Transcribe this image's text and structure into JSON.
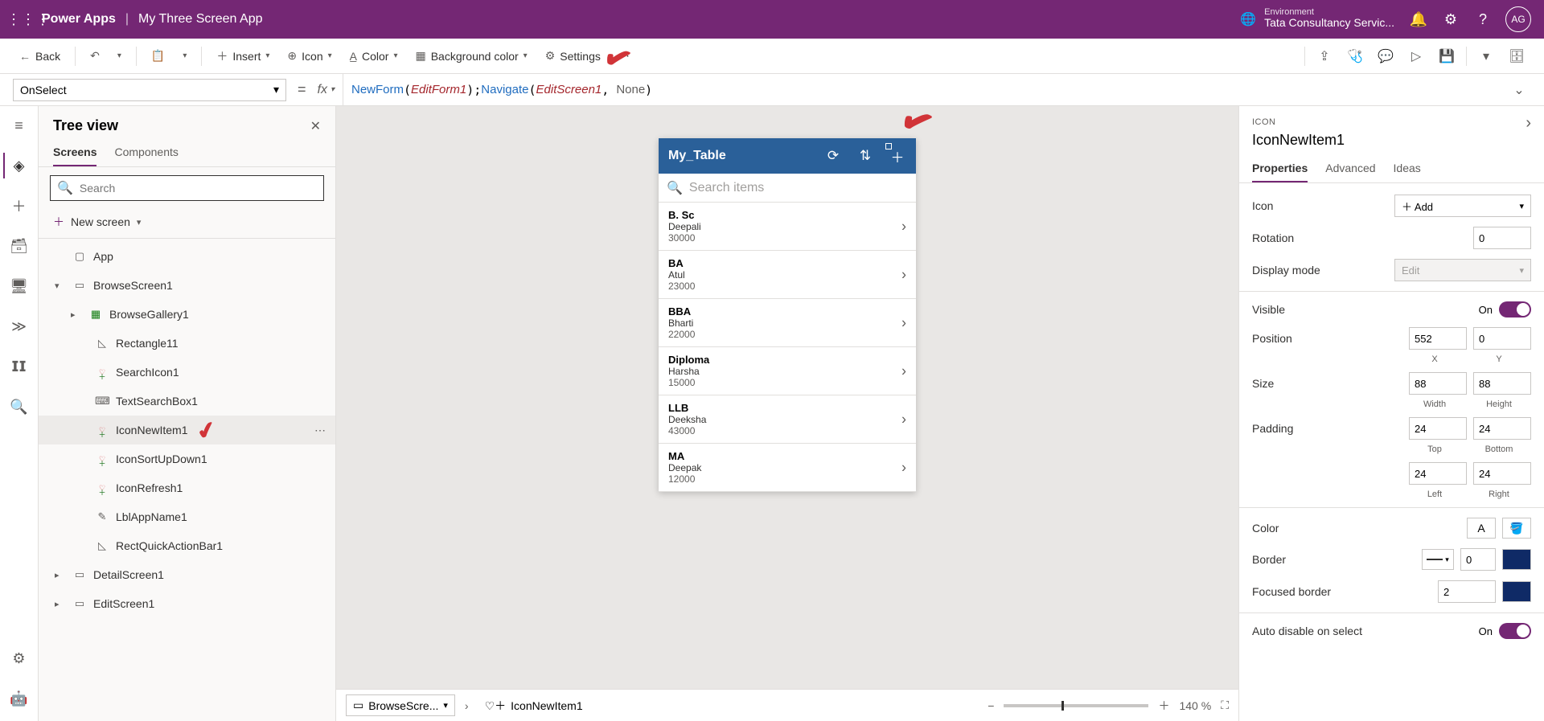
{
  "topbar": {
    "brand": "Power Apps",
    "appName": "My Three Screen App",
    "envLabel": "Environment",
    "envValue": "Tata Consultancy Servic...",
    "avatar": "AG"
  },
  "cmdbar": {
    "back": "Back",
    "insert": "Insert",
    "icon": "Icon",
    "color": "Color",
    "bgcolor": "Background color",
    "settings": "Settings"
  },
  "formula": {
    "property": "OnSelect",
    "fn1": "NewForm",
    "arg1": "EditForm1",
    "fn2": "Navigate",
    "arg2": "EditScreen1",
    "none": "None"
  },
  "tree": {
    "title": "Tree view",
    "tabScreens": "Screens",
    "tabComponents": "Components",
    "searchPlaceholder": "Search",
    "newScreen": "New screen",
    "app": "App",
    "browseScreen": "BrowseScreen1",
    "browseGallery": "BrowseGallery1",
    "rectangle": "Rectangle11",
    "searchIcon": "SearchIcon1",
    "textSearchBox": "TextSearchBox1",
    "iconNewItem": "IconNewItem1",
    "iconSortUpDown": "IconSortUpDown1",
    "iconRefresh": "IconRefresh1",
    "lblAppName": "LblAppName1",
    "rectQuick": "RectQuickActionBar1",
    "detailScreen": "DetailScreen1",
    "editScreen": "EditScreen1"
  },
  "phone": {
    "title": "My_Table",
    "searchPlaceholder": "Search items",
    "items": [
      {
        "title": "B. Sc",
        "sub": "Deepali",
        "val": "30000"
      },
      {
        "title": "BA",
        "sub": "Atul",
        "val": "23000"
      },
      {
        "title": "BBA",
        "sub": "Bharti",
        "val": "22000"
      },
      {
        "title": "Diploma",
        "sub": "Harsha",
        "val": "15000"
      },
      {
        "title": "LLB",
        "sub": "Deeksha",
        "val": "43000"
      },
      {
        "title": "MA",
        "sub": "Deepak",
        "val": "12000"
      }
    ]
  },
  "footer": {
    "breadcrumb1": "BrowseScre...",
    "breadcrumb2": "IconNewItem1",
    "zoom": "140 %"
  },
  "props": {
    "category": "ICON",
    "name": "IconNewItem1",
    "tabProps": "Properties",
    "tabAdvanced": "Advanced",
    "tabIdeas": "Ideas",
    "iconLabel": "Icon",
    "iconValue": "Add",
    "rotationLabel": "Rotation",
    "rotationValue": "0",
    "displayModeLabel": "Display mode",
    "displayModeValue": "Edit",
    "visibleLabel": "Visible",
    "visibleValue": "On",
    "positionLabel": "Position",
    "posX": "552",
    "posY": "0",
    "posXlabel": "X",
    "posYlabel": "Y",
    "sizeLabel": "Size",
    "sizeW": "88",
    "sizeH": "88",
    "sizeWlabel": "Width",
    "sizeHlabel": "Height",
    "paddingLabel": "Padding",
    "padT": "24",
    "padB": "24",
    "padTlabel": "Top",
    "padBlabel": "Bottom",
    "padL": "24",
    "padR": "24",
    "padLlabel": "Left",
    "padRlabel": "Right",
    "colorLabel": "Color",
    "borderLabel": "Border",
    "borderValue": "0",
    "focusedBorderLabel": "Focused border",
    "focusedBorderValue": "2",
    "autoDisableLabel": "Auto disable on select",
    "autoDisableValue": "On"
  }
}
